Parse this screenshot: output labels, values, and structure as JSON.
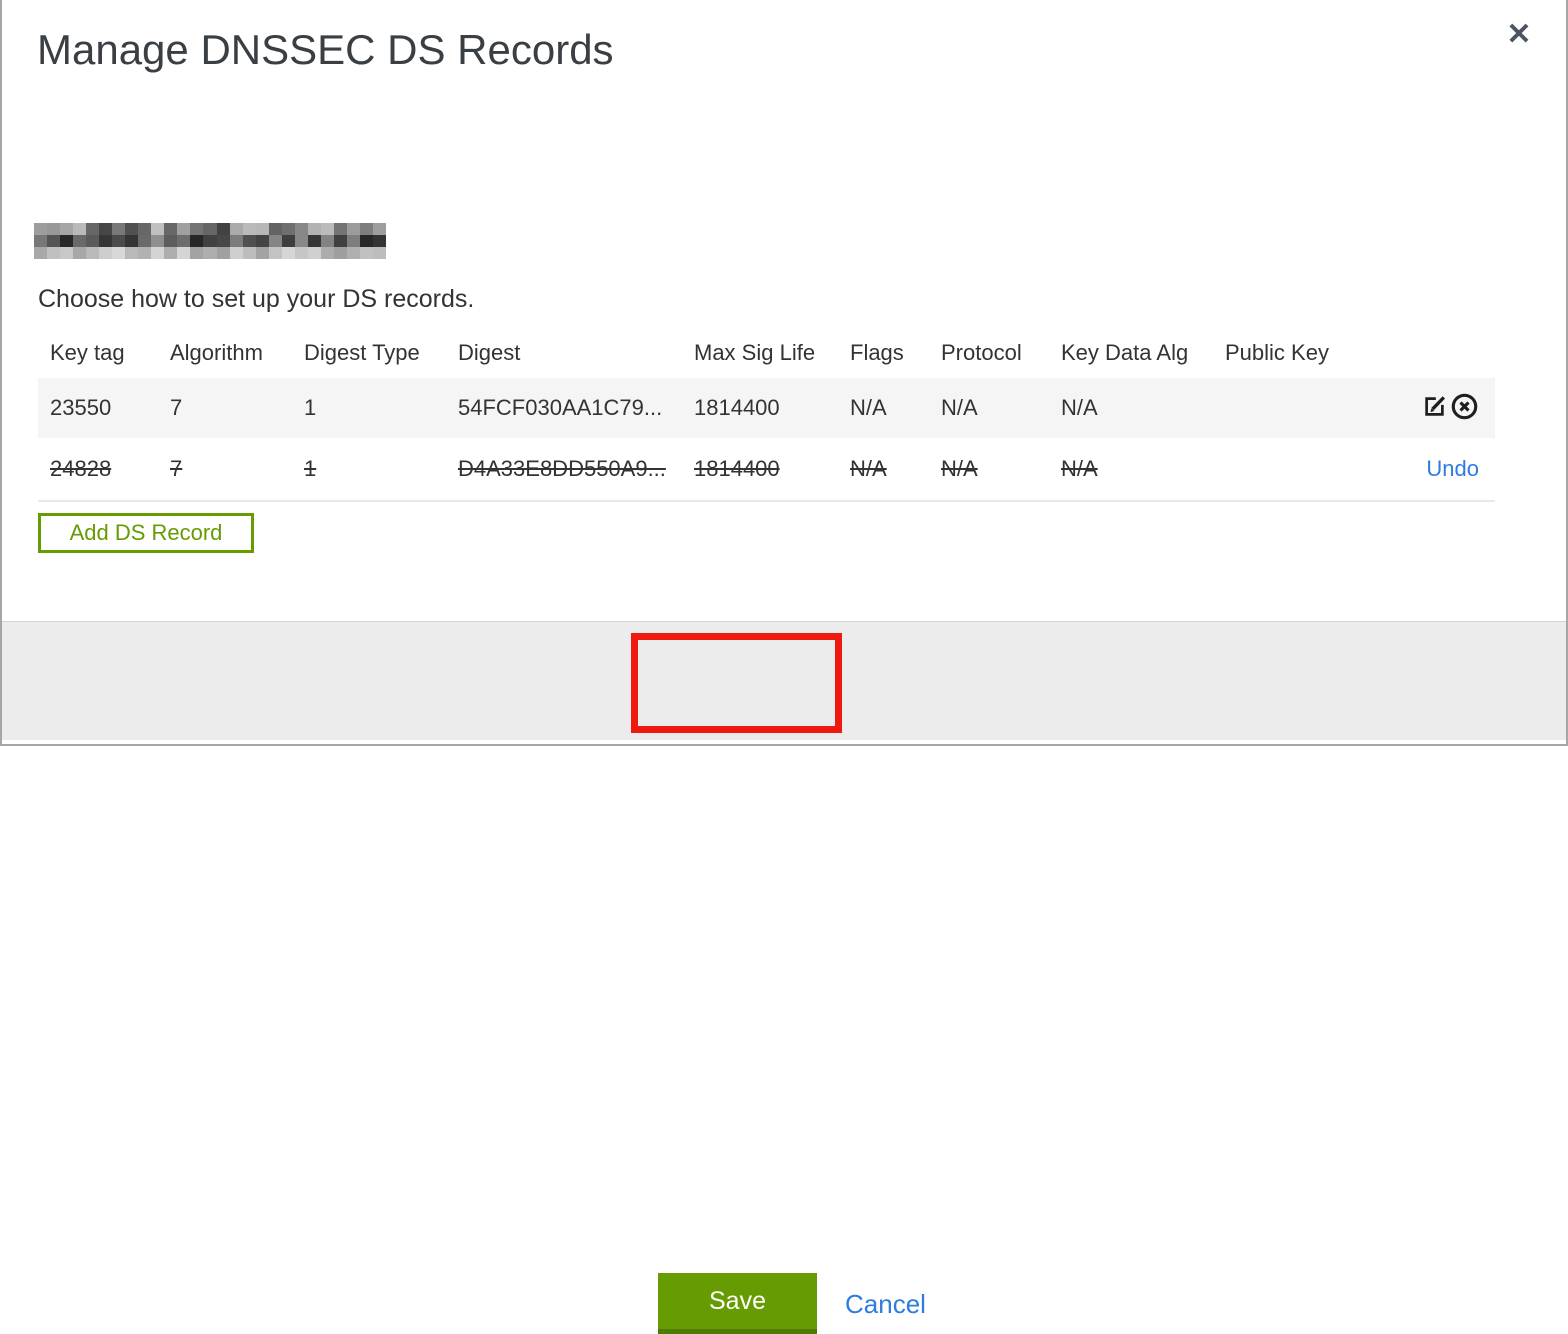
{
  "modal": {
    "title": "Manage DNSSEC DS Records",
    "close_icon": "✕",
    "domain": "(pixelated / redacted)",
    "instruction": "Choose how to set up your DS records.",
    "table": {
      "columns": [
        "Key tag",
        "Algorithm",
        "Digest Type",
        "Digest",
        "Max Sig Life",
        "Flags",
        "Protocol",
        "Key Data Alg",
        "Public Key"
      ],
      "rows": [
        {
          "cells": [
            "23550",
            "7",
            "1",
            "54FCF030AA1C79...",
            "1814400",
            "N/A",
            "N/A",
            "N/A",
            ""
          ],
          "state": "active",
          "action_icons": [
            "edit-icon",
            "delete-icon"
          ]
        },
        {
          "cells": [
            "24828",
            "7",
            "1",
            "D4A33E8DD550A9...",
            "1814400",
            "N/A",
            "N/A",
            "N/A",
            ""
          ],
          "state": "marked-for-deletion",
          "action_label": "Undo"
        }
      ]
    },
    "add_button_label": "Add DS Record",
    "footer": {
      "save_label": "Save",
      "cancel_label": "Cancel",
      "annotation": "red highlight rectangle around Save button"
    }
  },
  "colors": {
    "accent_green": "#669b02",
    "accent_green_dark": "#507a02",
    "link_blue": "#2e7ce0",
    "annotation_red": "#ee1a10",
    "row_highlight_bg": "#f5f5f5",
    "footer_bg": "#ececec",
    "title_text": "#3a3f44"
  }
}
